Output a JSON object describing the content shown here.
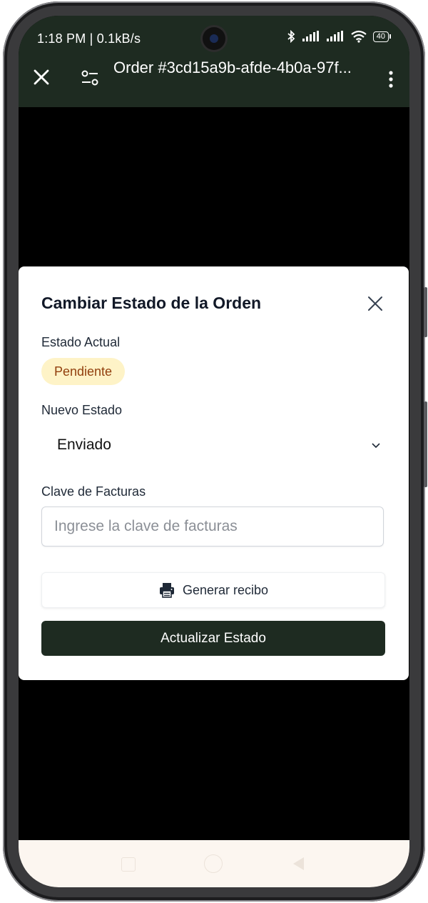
{
  "status_bar": {
    "time_net": "1:18 PM | 0.1kB/s",
    "battery": "40"
  },
  "toolbar": {
    "title": "Order #3cd15a9b-afde-4b0a-97f..."
  },
  "dialog": {
    "title": "Cambiar Estado de la Orden",
    "current_status_label": "Estado Actual",
    "current_status_value": "Pendiente",
    "new_status_label": "Nuevo Estado",
    "new_status_value": "Enviado",
    "invoice_key_label": "Clave de Facturas",
    "invoice_key_placeholder": "Ingrese la clave de facturas",
    "invoice_key_value": "",
    "receipt_button_label": "Generar recibo",
    "update_button_label": "Actualizar Estado"
  },
  "colors": {
    "toolbar_bg": "#1e2b21",
    "primary_button": "#1e2b21",
    "badge_bg": "#fef3c7",
    "badge_text": "#92400e"
  },
  "icons": {
    "toolbar_close": "close-icon",
    "toolbar_filter": "filter-icon",
    "toolbar_menu": "more-vertical-icon",
    "dialog_close": "close-icon",
    "select_chevron": "chevron-down-icon",
    "receipt": "printer-icon"
  }
}
